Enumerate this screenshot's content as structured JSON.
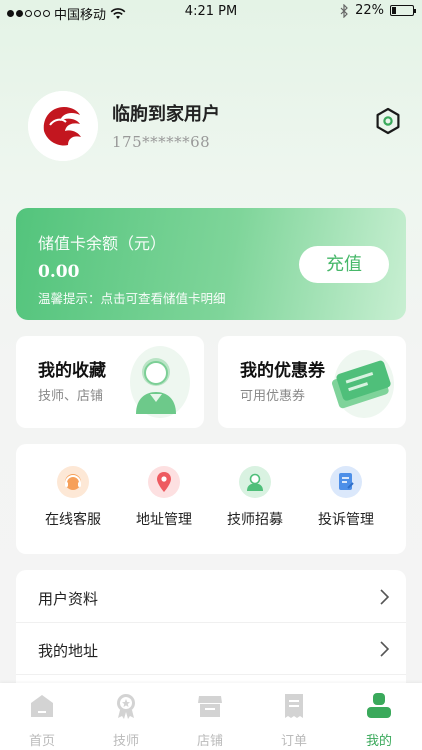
{
  "status_bar": {
    "carrier": "中国移动",
    "time": "4:21 PM",
    "battery": "22%",
    "battery_level": 0.22
  },
  "profile": {
    "name": "临朐到家用户",
    "phone": "175******68"
  },
  "balance_card": {
    "title": "储值卡余额（元）",
    "amount": "0.00",
    "tip": "温馨提示：点击可查看储值卡明细",
    "button": "充值"
  },
  "feature_cards": [
    {
      "title": "我的收藏",
      "subtitle": "技师、店铺"
    },
    {
      "title": "我的优惠券",
      "subtitle": "可用优惠券"
    }
  ],
  "services": [
    {
      "label": "在线客服",
      "icon": "headset-icon",
      "color": "#f6a05a"
    },
    {
      "label": "地址管理",
      "icon": "location-pin-icon",
      "color": "#ee5a60"
    },
    {
      "label": "技师招募",
      "icon": "technician-icon",
      "color": "#4fbf7a"
    },
    {
      "label": "投诉管理",
      "icon": "complaint-document-icon",
      "color": "#4d8fe8"
    }
  ],
  "menu_list": [
    {
      "label": "用户资料"
    },
    {
      "label": "我的地址"
    }
  ],
  "tabbar": {
    "active": 4,
    "items": [
      {
        "label": "首页",
        "icon": "home-icon"
      },
      {
        "label": "技师",
        "icon": "technician-badge-icon"
      },
      {
        "label": "店铺",
        "icon": "shop-icon"
      },
      {
        "label": "订单",
        "icon": "order-icon"
      },
      {
        "label": "我的",
        "icon": "profile-icon"
      }
    ]
  },
  "colors": {
    "accent": "#3aa95b",
    "card_gradient_start": "#53c47c",
    "inactive": "#bbbbbb"
  }
}
